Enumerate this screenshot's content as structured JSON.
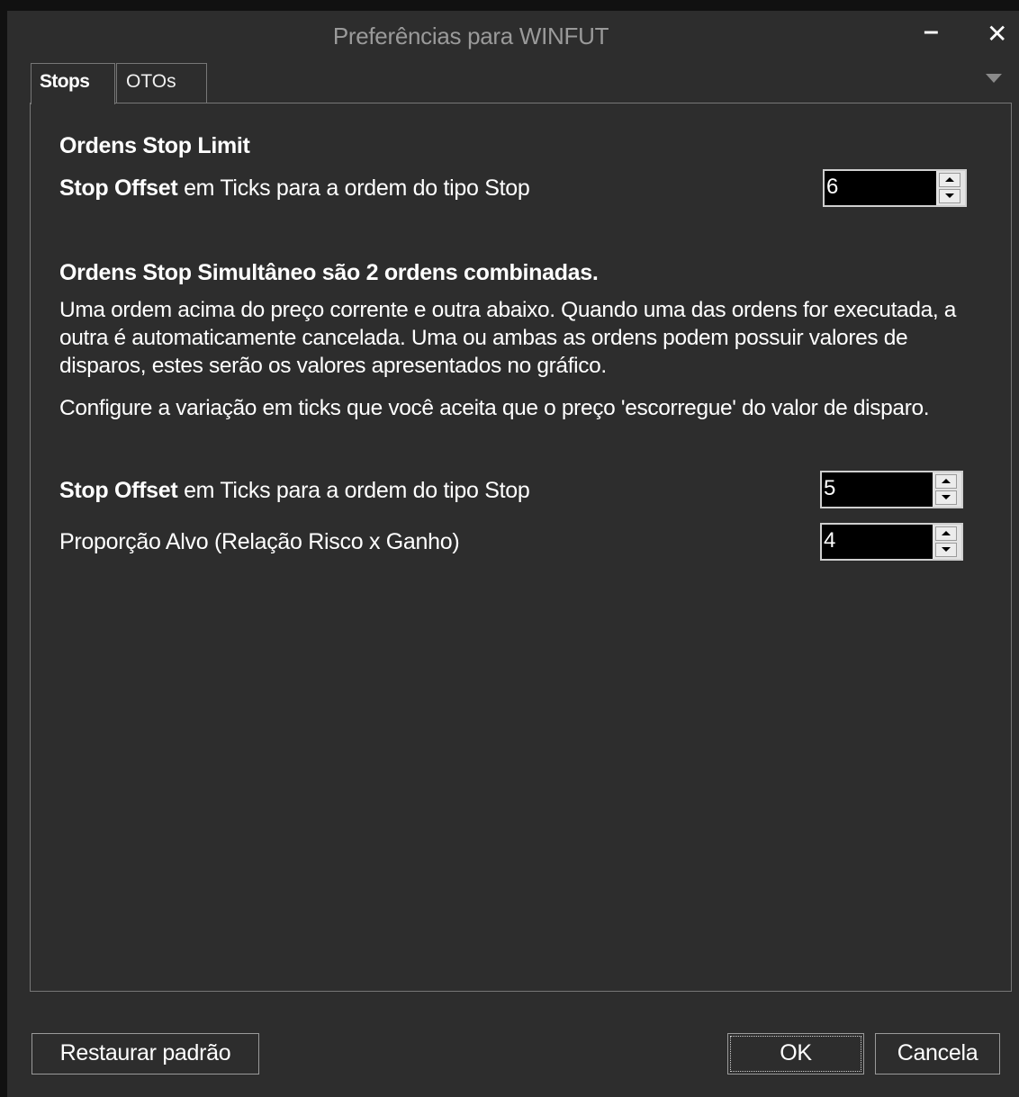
{
  "window": {
    "title": "Preferências para WINFUT",
    "minimize_label": "–",
    "close_label": "✕"
  },
  "tabs": [
    {
      "label": "Stops",
      "active": true
    },
    {
      "label": "OTOs",
      "active": false
    }
  ],
  "stop_limit": {
    "heading": "Ordens Stop Limit",
    "offset_label_bold": "Stop Offset",
    "offset_label_rest": " em Ticks para a ordem do tipo Stop",
    "offset_value": "6"
  },
  "stop_simultaneo": {
    "heading": "Ordens Stop Simultâneo são 2 ordens combinadas.",
    "description": "Uma ordem acima do preço corrente e outra abaixo. Quando uma das ordens for executada, a outra é automaticamente cancelada. Uma ou ambas as ordens podem possuir valores de disparos, estes serão os valores apresentados no gráfico.",
    "config_text": "Configure a variação em ticks que você aceita que o preço 'escorregue' do valor de disparo.",
    "offset_label_bold": "Stop Offset",
    "offset_label_rest": " em Ticks para a ordem do tipo Stop",
    "offset_value": "5",
    "ratio_label": "Proporção Alvo (Relação Risco x Ganho)",
    "ratio_value": "4"
  },
  "buttons": {
    "restore": "Restaurar padrão",
    "ok": "OK",
    "cancel": "Cancela"
  },
  "colors": {
    "background": "#2d2d2d",
    "title": "#9a9a9a",
    "border": "#777777",
    "input_bg": "#000000"
  }
}
